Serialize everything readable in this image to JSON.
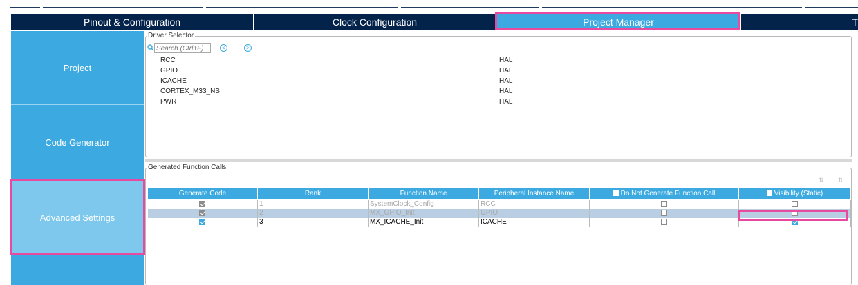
{
  "tabs": {
    "pinout": "Pinout & Configuration",
    "clock": "Clock Configuration",
    "project_manager": "Project Manager",
    "tools_partial": "T"
  },
  "nav": {
    "project": "Project",
    "code_generator": "Code Generator",
    "advanced_settings": "Advanced Settings"
  },
  "driver_selector": {
    "legend": "Driver Selector",
    "search_placeholder": "Search (Ctrl+F)",
    "prev_icon": "arrow-left-circle-icon",
    "next_icon": "arrow-right-circle-icon",
    "rows": [
      {
        "name": "RCC",
        "driver": "HAL"
      },
      {
        "name": "GPIO",
        "driver": "HAL"
      },
      {
        "name": "ICACHE",
        "driver": "HAL"
      },
      {
        "name": "CORTEX_M33_NS",
        "driver": "HAL"
      },
      {
        "name": "PWR",
        "driver": "HAL"
      }
    ]
  },
  "generated_calls": {
    "legend": "Generated Function Calls",
    "headers": {
      "generate_code": "Generate Code",
      "rank": "Rank",
      "function_name": "Function Name",
      "peripheral_instance": "Peripheral Instance Name",
      "do_not_generate": "Do Not Generate Function Call",
      "visibility": "Visibility (Static)"
    },
    "rows": [
      {
        "generate": true,
        "rank": "1",
        "function": "SystemClock_Config",
        "instance": "RCC",
        "do_not_generate": false,
        "visibility": false,
        "state": "disabled"
      },
      {
        "generate": true,
        "rank": "2",
        "function": "MX_GPIO_Init",
        "instance": "GPIO",
        "do_not_generate": false,
        "visibility": false,
        "state": "selected"
      },
      {
        "generate": true,
        "rank": "3",
        "function": "MX_ICACHE_Init",
        "instance": "ICACHE",
        "do_not_generate": false,
        "visibility": true,
        "state": "enabled"
      }
    ]
  },
  "colors": {
    "tab_bar": "#03234b",
    "accent": "#3caae0",
    "highlight": "#e84aa0",
    "selected_row": "#b9cde3"
  }
}
